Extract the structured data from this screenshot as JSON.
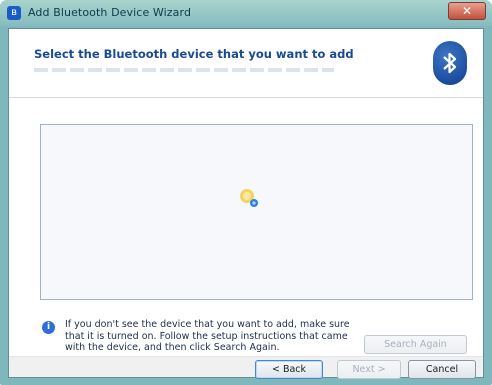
{
  "window": {
    "title": "Add Bluetooth Device Wizard",
    "close_label": "✕"
  },
  "header": {
    "title": "Select the Bluetooth device that you want to add"
  },
  "info": {
    "text": "If you don't see the device that you want to add, make sure that it is turned on. Follow the setup instructions that came with the device, and then click Search Again."
  },
  "buttons": {
    "search_again": "Search Again",
    "back": "< Back",
    "next": "Next >",
    "cancel": "Cancel"
  },
  "icons": {
    "app": "bluetooth-icon",
    "header_logo": "bluetooth-logo-icon",
    "info": "info-icon",
    "searching": "searching-animation-icon"
  },
  "colors": {
    "title_bar": "#86bcc0",
    "header_title": "#1a4a94",
    "bluetooth_blue": "#0d3e8f"
  }
}
